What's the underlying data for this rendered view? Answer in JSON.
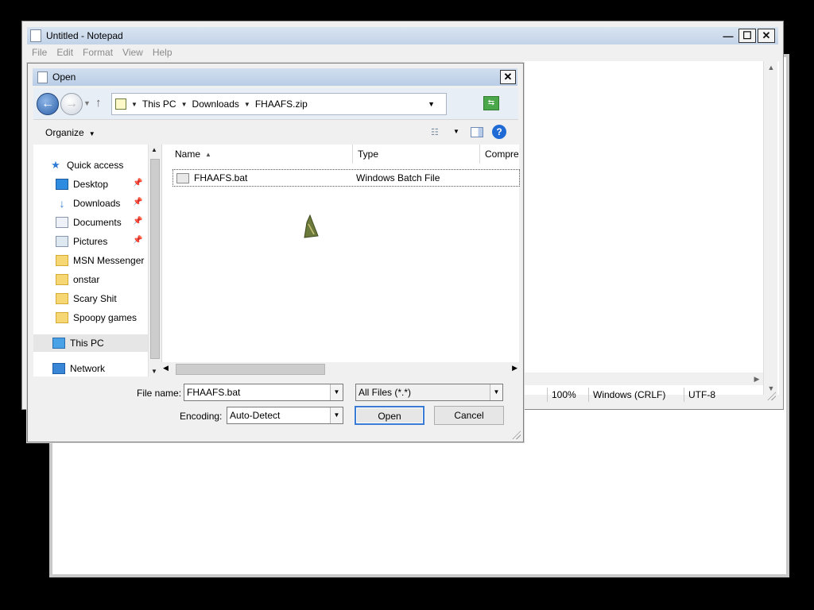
{
  "notepad": {
    "title": "Untitled - Notepad",
    "menu": [
      "File",
      "Edit",
      "Format",
      "View",
      "Help"
    ],
    "window_buttons": {
      "minimize": "—",
      "maximize": "☐",
      "close": "✕"
    },
    "status": {
      "zoom": "100%",
      "line_ending": "Windows (CRLF)",
      "encoding": "UTF-8"
    }
  },
  "dialog": {
    "title": "Open",
    "close_glyph": "✕",
    "address": {
      "crumbs": [
        "This PC",
        "Downloads",
        "FHAAFS.zip"
      ]
    },
    "toolbar": {
      "organize": "Organize"
    },
    "nav": {
      "items": [
        {
          "label": "Quick access",
          "icon": "star-icon",
          "pinned": false
        },
        {
          "label": "Desktop",
          "icon": "desktop-icon",
          "pinned": true
        },
        {
          "label": "Downloads",
          "icon": "download-icon",
          "pinned": true
        },
        {
          "label": "Documents",
          "icon": "documents-icon",
          "pinned": true
        },
        {
          "label": "Pictures",
          "icon": "pictures-icon",
          "pinned": true
        },
        {
          "label": "MSN Messenger",
          "icon": "folder-icon",
          "pinned": false
        },
        {
          "label": "onstar",
          "icon": "folder-icon",
          "pinned": false
        },
        {
          "label": "Scary Shit",
          "icon": "folder-icon",
          "pinned": false
        },
        {
          "label": "Spoopy games",
          "icon": "folder-icon",
          "pinned": false
        },
        {
          "label": "This PC",
          "icon": "computer-icon",
          "pinned": false
        },
        {
          "label": "Network",
          "icon": "network-icon",
          "pinned": false
        }
      ]
    },
    "columns": [
      "Name",
      "Type",
      "Compre"
    ],
    "files": [
      {
        "name": "FHAAFS.bat",
        "type": "Windows Batch File"
      }
    ],
    "file_name_label": "File name:",
    "file_name_value": "FHAAFS.bat",
    "file_type_value": "All Files  (*.*)",
    "encoding_label": "Encoding:",
    "encoding_value": "Auto-Detect",
    "open_button": "Open",
    "cancel_button": "Cancel"
  }
}
